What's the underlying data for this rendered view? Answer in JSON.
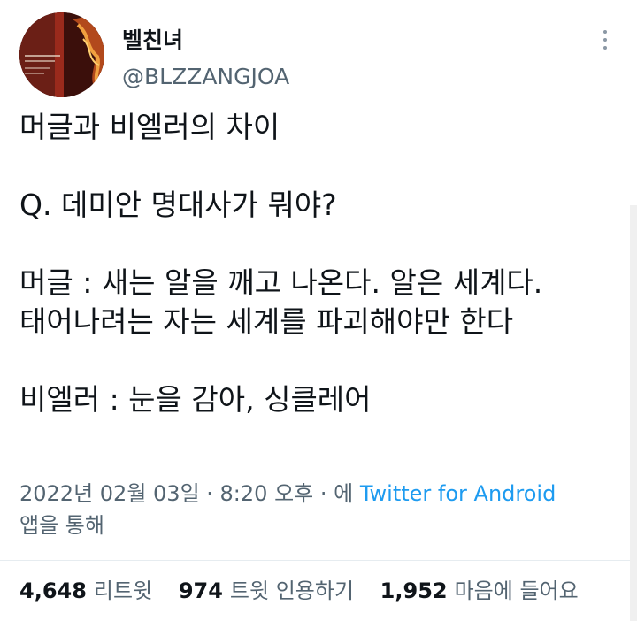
{
  "tweet": {
    "author": {
      "display_name": "벨친녀",
      "handle": "@BLZZANGJOA",
      "avatar": "book-cover-avatar"
    },
    "menu_icon": "more-vertical-icon",
    "text_lines": [
      "머글과 비엘러의 차이",
      "",
      "Q. 데미안 명대사가 뭐야?",
      "",
      "머글 : 새는 알을 깨고 나온다. 알은 세계다.",
      "태어나려는 자는 세계를 파괴해야만 한다",
      "",
      "비엘러 : 눈을 감아, 싱클레어"
    ],
    "timestamp": "2022년 02월 03일 · 8:20 오후 · 에",
    "source": "Twitter for Android",
    "source_suffix": "앱을 통해",
    "stats": {
      "retweets": {
        "count": "4,648",
        "label": "리트윗"
      },
      "quotes": {
        "count": "974",
        "label": "트윗 인용하기"
      },
      "likes": {
        "count": "1,952",
        "label": "마음에 들어요"
      }
    }
  },
  "colors": {
    "primary_text": "#0f1419",
    "secondary_text": "#536471",
    "link": "#1d9bf0",
    "divider": "#e6ecf0"
  }
}
